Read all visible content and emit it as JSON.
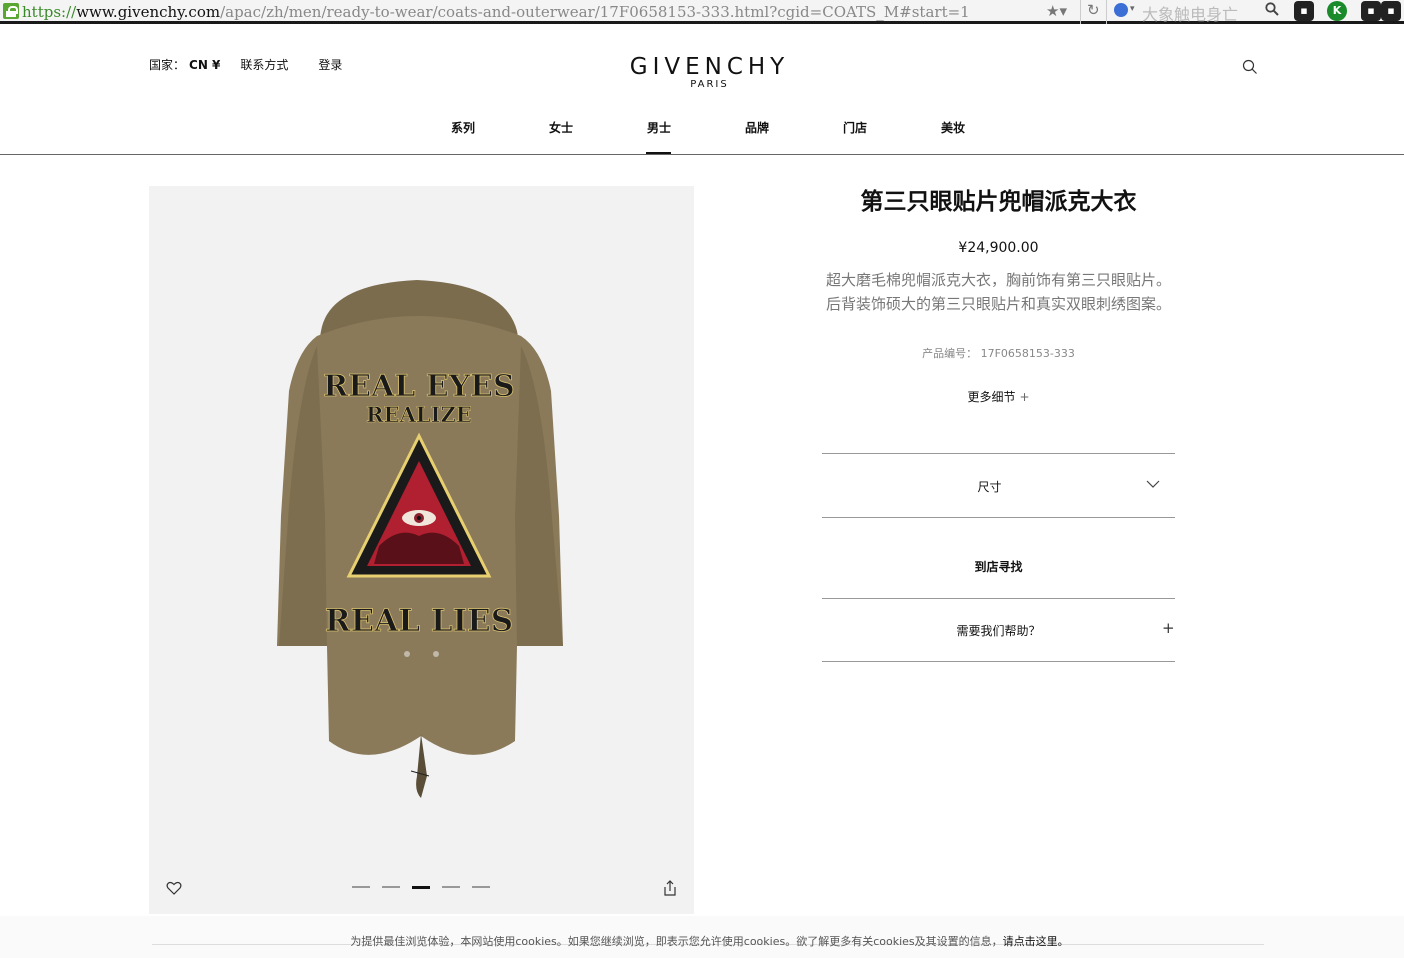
{
  "browser": {
    "url_scheme": "https://",
    "url_host": "www.givenchy.com",
    "url_path": "/apac/zh/men/ready-to-wear/coats-and-outerwear/17F0658153-333.html?cgid=COATS_M#start=1",
    "search_text": "大象触电身亡",
    "extensions": [
      "chat",
      "K",
      "lock"
    ]
  },
  "header": {
    "country_label": "国家：",
    "country_value": "CN ¥",
    "contact": "联系方式",
    "login": "登录",
    "logo": "GIVENCHY",
    "logo_sub": "PARIS"
  },
  "nav": {
    "items": [
      {
        "label": "系列"
      },
      {
        "label": "女士"
      },
      {
        "label": "男士",
        "active": true
      },
      {
        "label": "品牌"
      },
      {
        "label": "门店"
      },
      {
        "label": "美妆"
      }
    ]
  },
  "product": {
    "title": "第三只眼贴片兜帽派克大衣",
    "price": "¥24,900.00",
    "description": "超大磨毛棉兜帽派克大衣，胸前饰有第三只眼贴片。后背装饰硕大的第三只眼贴片和真实双眼刺绣图案。",
    "code": "产品编号： 17F0658153-333",
    "more_details": "更多细节",
    "more_details_plus": "+",
    "size_label": "尺寸",
    "store_label": "到店寻找",
    "help_label": "需要我们帮助？",
    "help_plus": "+",
    "image_text_top": "REAL EYES",
    "image_text_mid": "REALIZE",
    "image_text_bottom": "REAL LIES",
    "carousel": {
      "count": 5,
      "active_index": 2
    },
    "coat_color": "#8a7a5a"
  },
  "cookie": {
    "text": "为提供最佳浏览体验，本网站使用cookies。如果您继续浏览，即表示您允许使用cookies。欲了解更多有关cookies及其设置的信息，",
    "link": "请点击这里。"
  }
}
